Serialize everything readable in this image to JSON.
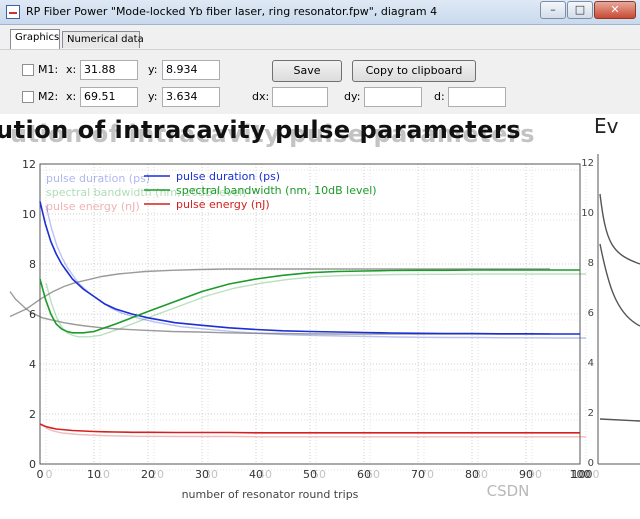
{
  "window": {
    "title": "RP Fiber Power \"Mode-locked Yb fiber laser, ring resonator.fpw\", diagram 4",
    "minimize_glyph": "–",
    "maximize_glyph": "□",
    "close_glyph": "✕"
  },
  "tabs": [
    {
      "label": "Graphics",
      "active": true
    },
    {
      "label": "Numerical data",
      "active": false
    }
  ],
  "markers": {
    "m1": {
      "label": "M1:",
      "x_label": "x:",
      "x_value": "31.88",
      "y_label": "y:",
      "y_value": "8.934"
    },
    "m2": {
      "label": "M2:",
      "x_label": "x:",
      "x_value": "69.51",
      "y_label": "y:",
      "y_value": "3.634"
    }
  },
  "buttons": {
    "save": "Save",
    "copy": "Copy to clipboard"
  },
  "deltas": {
    "dx_label": "dx:",
    "dy_label": "dy:",
    "d_label": "d:"
  },
  "plot": {
    "title": "ution of intracavity pulse parameters",
    "right_title": "Ev",
    "right_panel_ticks": {
      "y": [
        "12",
        "10",
        "8",
        "6",
        "4",
        "2",
        "0"
      ],
      "x_end": "100"
    }
  },
  "chart_data": {
    "type": "line",
    "title": "ution of intracavity pulse parameters",
    "xlabel": "number of resonator round trips",
    "ylabel": "",
    "xlim": [
      0,
      100
    ],
    "ylim": [
      0,
      12
    ],
    "x_ticks": [
      "0",
      "10",
      "20",
      "30",
      "40",
      "50",
      "60",
      "70",
      "80",
      "90",
      "100"
    ],
    "y_ticks": [
      "0",
      "2",
      "4",
      "6",
      "8",
      "10",
      "12"
    ],
    "grid": true,
    "legend_position": "top-left",
    "x": [
      0,
      1,
      2,
      3,
      4,
      5,
      6,
      8,
      10,
      12,
      14,
      17,
      20,
      25,
      30,
      35,
      40,
      45,
      50,
      55,
      60,
      65,
      70,
      75,
      80,
      85,
      90,
      95,
      100
    ],
    "series": [
      {
        "name": "pulse duration (ps)",
        "color": "#1a2fd6",
        "values": [
          10.5,
          9.6,
          8.9,
          8.4,
          8.0,
          7.7,
          7.4,
          7.0,
          6.7,
          6.4,
          6.2,
          6.0,
          5.85,
          5.65,
          5.55,
          5.45,
          5.38,
          5.33,
          5.3,
          5.28,
          5.26,
          5.24,
          5.23,
          5.22,
          5.22,
          5.21,
          5.21,
          5.2,
          5.2
        ]
      },
      {
        "name": "spectral bandwidth (nm, 10dB level)",
        "color": "#1c9a2a",
        "values": [
          7.4,
          6.6,
          6.0,
          5.6,
          5.4,
          5.3,
          5.25,
          5.25,
          5.3,
          5.45,
          5.6,
          5.85,
          6.1,
          6.5,
          6.9,
          7.2,
          7.4,
          7.55,
          7.65,
          7.7,
          7.72,
          7.74,
          7.75,
          7.75,
          7.76,
          7.76,
          7.76,
          7.76,
          7.76
        ]
      },
      {
        "name": "pulse energy (nJ)",
        "color": "#d42020",
        "values": [
          1.6,
          1.5,
          1.45,
          1.4,
          1.38,
          1.36,
          1.34,
          1.32,
          1.3,
          1.29,
          1.28,
          1.27,
          1.27,
          1.26,
          1.26,
          1.26,
          1.25,
          1.25,
          1.25,
          1.25,
          1.25,
          1.25,
          1.25,
          1.25,
          1.25,
          1.25,
          1.25,
          1.25,
          1.25
        ]
      }
    ]
  },
  "watermark": "CSDN"
}
